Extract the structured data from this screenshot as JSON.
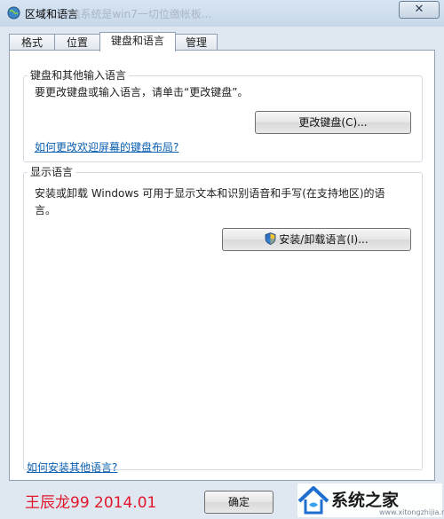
{
  "window": {
    "title": "区域和语言",
    "close_glyph": "✕",
    "ghost_text": "...电脑系统是win7一切位缴帐板..."
  },
  "tabs": [
    "格式",
    "位置",
    "键盘和语言",
    "管理"
  ],
  "keyboard_group": {
    "title": "键盘和其他输入语言",
    "description": "要更改键盘或输入语言，请单击“更改键盘”。",
    "button": "更改键盘(C)...",
    "link": "如何更改欢迎屏幕的键盘布局?"
  },
  "display_group": {
    "title": "显示语言",
    "description_line1": "安装或卸载 Windows 可用于显示文本和识别语音和手写(在支持地区)的语",
    "description_line2": "言。",
    "button": "安装/卸载语言(I)...",
    "button_icon": "uac-shield-icon"
  },
  "bottom_link": "如何安装其他语言?",
  "footer": {
    "ok_button": "确定"
  },
  "watermarks": {
    "left": "王辰龙99 2014.01",
    "right": "系统之家",
    "right_url": "www.xitongzhijia.net"
  },
  "colors": {
    "link": "#0b5fb0",
    "accent_red": "#e2162b",
    "window_frame": "#dfe8f1"
  }
}
